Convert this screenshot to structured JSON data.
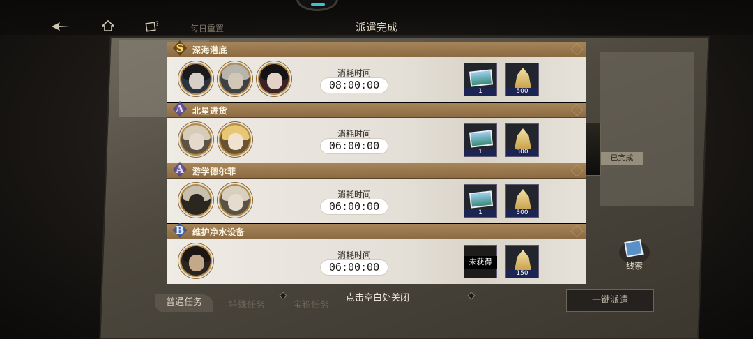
{
  "topbar": {
    "daily_reset": "每日重置",
    "title": "派遣完成"
  },
  "status_tag": "已完成",
  "missions": [
    {
      "grade": "S",
      "name": "深海潜底",
      "time_label": "消耗时间",
      "time": "08:00:00",
      "rewards": [
        {
          "icon": "photo-icon",
          "count": "1"
        },
        {
          "icon": "gold-icon",
          "count": "500"
        }
      ],
      "avatars": 3
    },
    {
      "grade": "A",
      "name": "北星进货",
      "time_label": "消耗时间",
      "time": "06:00:00",
      "rewards": [
        {
          "icon": "photo-icon",
          "count": "1"
        },
        {
          "icon": "gold-icon",
          "count": "300"
        }
      ],
      "avatars": 2
    },
    {
      "grade": "A",
      "name": "游学德尔菲",
      "time_label": "消耗时间",
      "time": "06:00:00",
      "rewards": [
        {
          "icon": "photo-icon",
          "count": "1"
        },
        {
          "icon": "gold-icon",
          "count": "300"
        }
      ],
      "avatars": 2
    },
    {
      "grade": "B",
      "name": "维护净水设备",
      "time_label": "消耗时间",
      "time": "06:00:00",
      "rewards": [
        {
          "icon": "locked-reward-icon",
          "status": "未获得"
        },
        {
          "icon": "gold-icon",
          "count": "150"
        }
      ],
      "avatars": 1
    }
  ],
  "bottom": {
    "tabs": [
      "普通任务",
      "特殊任务",
      "宝箱任务"
    ],
    "close_hint": "点击空白处关闭",
    "dispatch_all": "一键派遣",
    "clues": "线索"
  },
  "colors": {
    "header_gold": "#a88559",
    "time_pill": "#ffffff",
    "reward_count_bg": "#1c2453",
    "accent_teal": "#3fc2c8"
  }
}
